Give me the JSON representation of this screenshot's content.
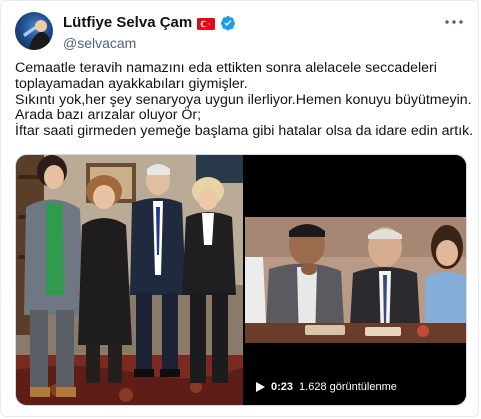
{
  "user": {
    "display_name": "Lütfiye Selva Çam",
    "handle": "@selvacam",
    "flag_icon": "turkey-flag-icon",
    "verified_icon": "verified-badge-icon",
    "verified_color": "#1d9bf0"
  },
  "tweet": {
    "lines": [
      "Cemaatle teravih namazını eda ettikten sonra alelacele seccadeleri",
      "toplayamadan ayakkabıları giymişler.",
      "Sıkıntı yok,her şey senaryoya uygun ilerliyor.Hemen konuyu büyütmeyin.",
      "Arada bazı arızalar oluyor Ör;",
      "İftar saati girmeden yemeğe başlama gibi hatalar olsa da idare edin artık."
    ]
  },
  "media": {
    "video": {
      "duration": "0:23",
      "views": "1.628 görüntülenme",
      "play_icon": "play-icon"
    }
  },
  "header": {
    "more_icon": "more-options-icon"
  }
}
